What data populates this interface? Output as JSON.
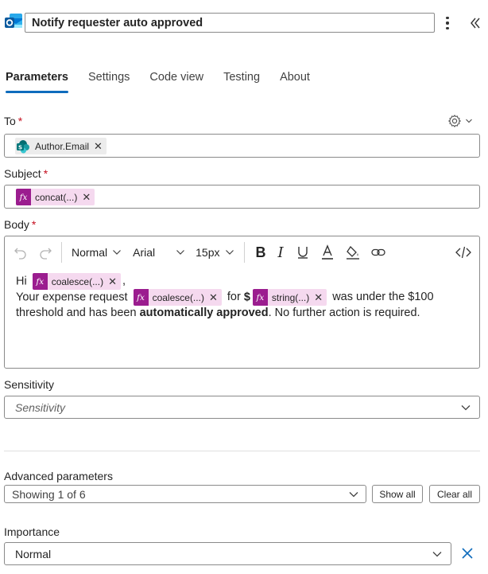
{
  "header": {
    "title": "Notify requester auto approved",
    "more_icon": "more-vertical-icon",
    "collapse_icon": "double-chevron-left-icon"
  },
  "tabs": [
    {
      "label": "Parameters",
      "active": true
    },
    {
      "label": "Settings",
      "active": false
    },
    {
      "label": "Code view",
      "active": false
    },
    {
      "label": "Testing",
      "active": false
    },
    {
      "label": "About",
      "active": false
    }
  ],
  "to": {
    "label": "To",
    "required_mark": "*",
    "token": "Author.Email"
  },
  "subject": {
    "label": "Subject",
    "required_mark": "*",
    "token": "concat(...)"
  },
  "body": {
    "label": "Body",
    "required_mark": "*",
    "toolbar": {
      "style": "Normal",
      "font": "Arial",
      "size": "15px"
    },
    "content": {
      "hi": "Hi",
      "token1": "coalesce(...)",
      "comma": ",",
      "line2_start": "Your expense request",
      "token2": "coalesce(...)",
      "for": "for",
      "dollar": "$",
      "token3": "string(...)",
      "line2_end": "was under the $100",
      "line3_start": "threshold and has been",
      "line3_bold": "automatically approved",
      "line3_end": ". No further action is required."
    }
  },
  "sensitivity": {
    "label": "Sensitivity",
    "placeholder": "Sensitivity"
  },
  "advanced": {
    "label": "Advanced parameters",
    "value": "Showing 1 of 6",
    "show_all": "Show all",
    "clear_all": "Clear all"
  },
  "importance": {
    "label": "Importance",
    "value": "Normal"
  },
  "colors": {
    "accent": "#0f6cbd",
    "required": "#c50f1f",
    "fx_token": "#9b1d8f",
    "fx_token_bg": "#f5d9ef"
  }
}
